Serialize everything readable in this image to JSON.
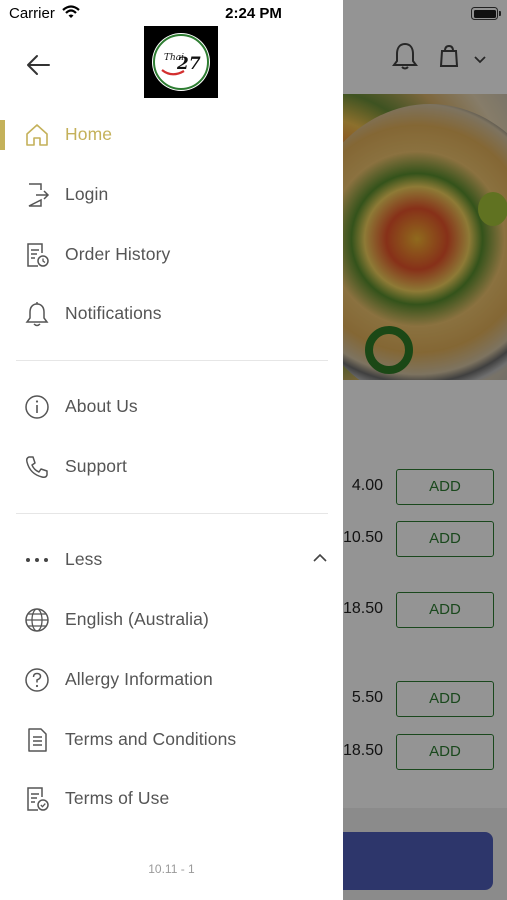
{
  "status_bar": {
    "carrier": "Carrier",
    "time": "2:24 PM"
  },
  "background": {
    "prices": [
      "4.00",
      "10.50",
      "18.50",
      "5.50",
      "18.50"
    ],
    "add_label": "ADD"
  },
  "drawer": {
    "logo_text": "Thai 27",
    "primary_items": [
      {
        "label": "Home",
        "icon": "home-icon",
        "active": true
      },
      {
        "label": "Login",
        "icon": "login-icon"
      },
      {
        "label": "Order History",
        "icon": "order-history-icon"
      },
      {
        "label": "Notifications",
        "icon": "bell-icon"
      }
    ],
    "secondary_items": [
      {
        "label": "About Us",
        "icon": "info-icon"
      },
      {
        "label": "Support",
        "icon": "phone-icon"
      }
    ],
    "more_toggle": {
      "label": "Less",
      "icon": "more-dots-icon",
      "expanded": true
    },
    "extra_items": [
      {
        "label": "English (Australia)",
        "icon": "globe-icon"
      },
      {
        "label": "Allergy Information",
        "icon": "help-circle-icon"
      },
      {
        "label": "Terms and Conditions",
        "icon": "document-icon"
      },
      {
        "label": "Terms of Use",
        "icon": "document-check-icon"
      }
    ],
    "version": "10.11 - 1"
  },
  "colors": {
    "accent": "#c4b15a",
    "add_green": "#2e7d32",
    "checkout_blue": "#4f5db8"
  }
}
